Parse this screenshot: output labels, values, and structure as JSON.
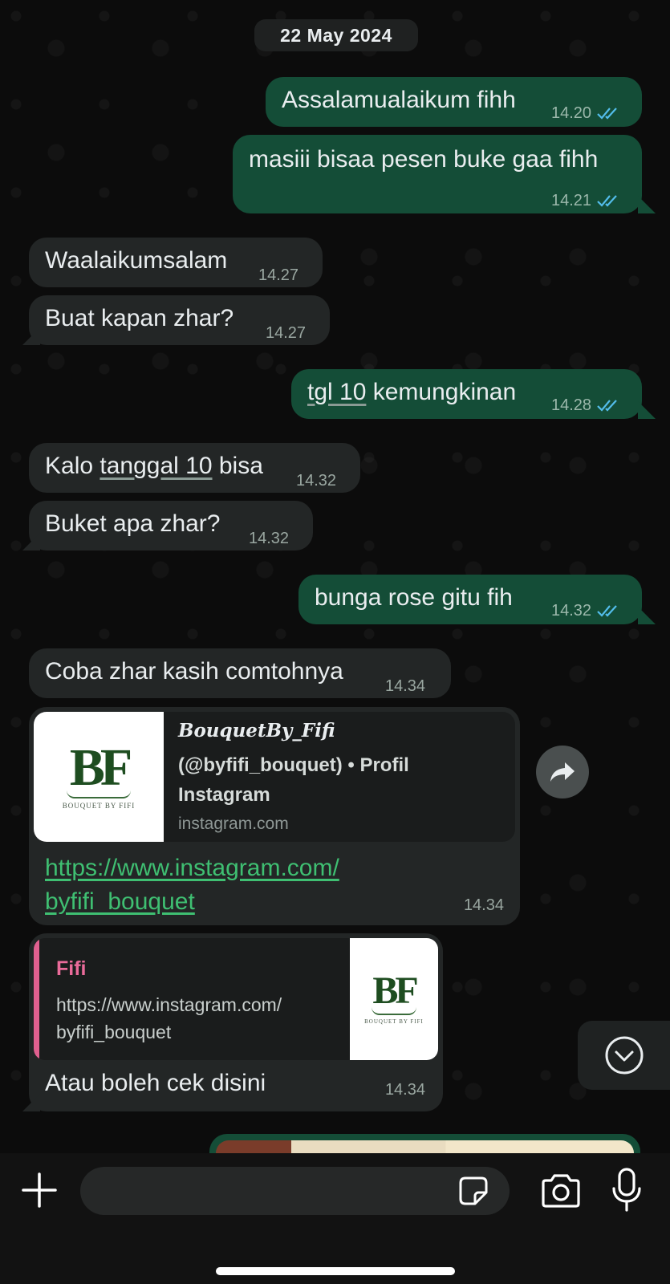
{
  "date_separator": "22 May 2024",
  "messages": [
    {
      "dir": "out",
      "text": "Assalamualaikum fihh",
      "time": "14.20"
    },
    {
      "dir": "out",
      "text": "masiii bisaa pesen buke gaa fihh",
      "time": "14.21"
    },
    {
      "dir": "in",
      "text": "Waalaikumsalam",
      "time": "14.27"
    },
    {
      "dir": "in",
      "text": "Buat kapan zhar?",
      "time": "14.27"
    },
    {
      "dir": "out",
      "text_underlined": "tgl 10",
      "text_rest": " kemungkinan",
      "time": "14.28"
    },
    {
      "dir": "in",
      "text_before": "Kalo ",
      "text_underlined": "tanggal 10",
      "text_after": " bisa",
      "time": "14.32"
    },
    {
      "dir": "in",
      "text": "Buket apa zhar?",
      "time": "14.32"
    },
    {
      "dir": "out",
      "text": "bunga rose gitu fih",
      "time": "14.32"
    },
    {
      "dir": "in",
      "text": "Coba zhar kasih comtohnya",
      "time": "14.34"
    }
  ],
  "link_message": {
    "preview_title": "BouquetBy_Fifi",
    "preview_desc": "(@byfifi_bouquet) • Profil Instagram",
    "preview_host": "instagram.com",
    "url_line1": "https://www.instagram.com/",
    "url_line2": "byfifi_bouquet",
    "time": "14.34",
    "logo_letters": "BF",
    "logo_sub": "BOUQUET BY FIFI"
  },
  "reply_message": {
    "quoted_name": "Fifi",
    "quoted_text_line1": "https://www.instagram.com/",
    "quoted_text_line2": "byfifi_bouquet",
    "text": "Atau boleh cek disini",
    "time": "14.34",
    "logo_letters": "BF",
    "logo_sub": "BOUQUET BY FIFI"
  },
  "input": {
    "value": "",
    "placeholder": ""
  },
  "icons": {
    "plus": "plus-icon",
    "sticker": "sticker-icon",
    "camera": "camera-icon",
    "mic": "microphone-icon",
    "forward": "forward-icon",
    "scroll_down": "chevron-down-icon",
    "read_ticks": "double-check-icon"
  },
  "colors": {
    "outgoing_bubble": "#144d37",
    "incoming_bubble": "#232626",
    "link": "#3fbf72",
    "ticks": "#53bdeb",
    "quote_accent": "#e0608f"
  }
}
